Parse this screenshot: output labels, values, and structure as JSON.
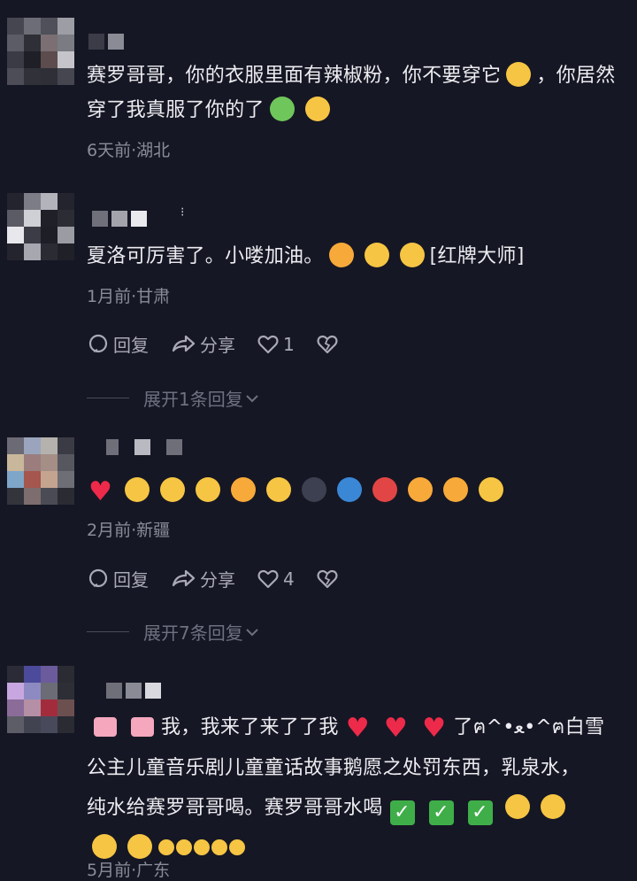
{
  "comments": [
    {
      "text_parts": [
        "赛罗哥哥，你的衣服里面有辣椒粉，你不要穿它",
        "，你居然穿了我真服了你的了"
      ],
      "meta": "6天前·湖北"
    },
    {
      "text": "夏洛可厉害了。小喽加油。",
      "tag": "[红牌大师]",
      "meta": "1月前·甘肃",
      "reply_label": "回复",
      "share_label": "分享",
      "like_count": "1",
      "expand_label": "展开1条回复"
    },
    {
      "meta": "2月前·新疆",
      "reply_label": "回复",
      "share_label": "分享",
      "like_count": "4",
      "expand_label": "展开7条回复"
    },
    {
      "text_a": "我，我来了来了了我",
      "text_b": "了ฅ^•ﻌ•^ฅ白雪",
      "text_line2": "公主儿童音乐剧儿童童话故事鹅愿之处罚东西，乳泉水，",
      "text_line3": "纯水给赛罗哥哥喝。赛罗哥哥水喝",
      "meta": "5月前·广东"
    }
  ],
  "icons": [
    "scream-icon",
    "virus-face-icon",
    "medal-icon",
    "grin-icon",
    "heart-icon",
    "reply-icon",
    "share-icon",
    "like-icon",
    "dislike-icon",
    "chevron-down-icon",
    "cake-icon",
    "check-icon",
    "angel-icon",
    "sweat-smile-icon",
    "pleading-icon"
  ]
}
